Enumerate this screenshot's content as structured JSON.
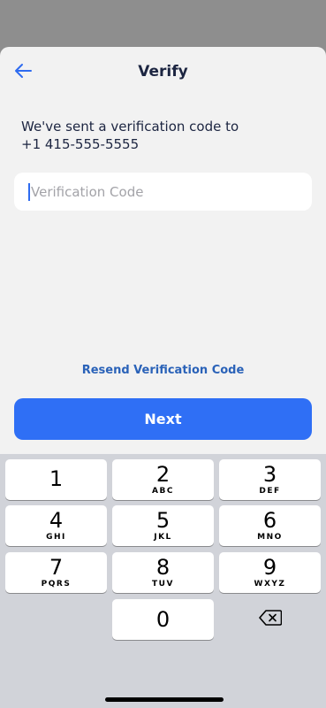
{
  "header": {
    "title": "Verify",
    "back_icon": "arrow-left-icon"
  },
  "message": {
    "line1": "We've sent a verification code to",
    "phone": "+1 415-555-5555"
  },
  "code_input": {
    "placeholder": "Verification Code",
    "value": ""
  },
  "resend_label": "Resend Verification Code",
  "next_label": "Next",
  "colors": {
    "accent": "#2f6ff5",
    "link": "#2a62b8",
    "text": "#1c2541"
  },
  "keyboard": {
    "keys": [
      {
        "digit": "1",
        "letters": ""
      },
      {
        "digit": "2",
        "letters": "ABC"
      },
      {
        "digit": "3",
        "letters": "DEF"
      },
      {
        "digit": "4",
        "letters": "GHI"
      },
      {
        "digit": "5",
        "letters": "JKL"
      },
      {
        "digit": "6",
        "letters": "MNO"
      },
      {
        "digit": "7",
        "letters": "PQRS"
      },
      {
        "digit": "8",
        "letters": "TUV"
      },
      {
        "digit": "9",
        "letters": "WXYZ"
      },
      {
        "digit": "0",
        "letters": ""
      }
    ],
    "delete_icon": "backspace-icon"
  }
}
